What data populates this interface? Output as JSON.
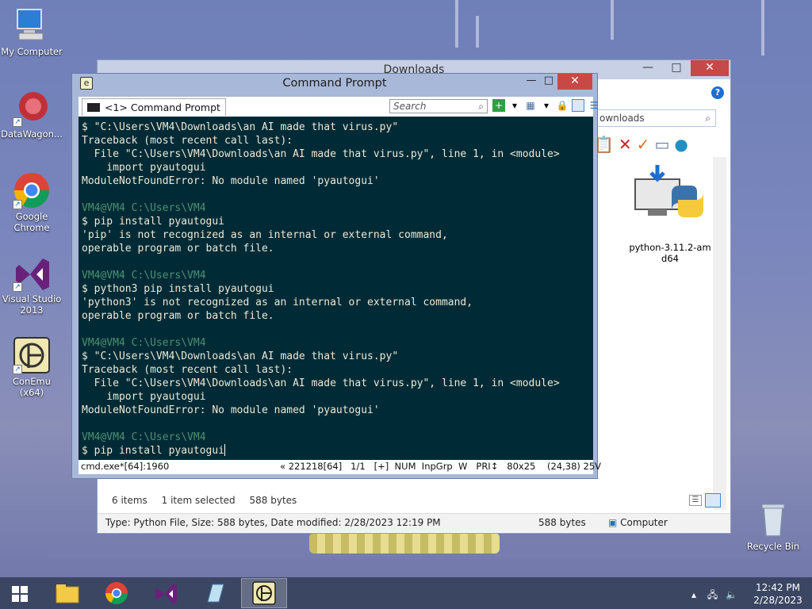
{
  "desktop": {
    "icons": [
      {
        "label": "My Computer"
      },
      {
        "label": "DataWagon..."
      },
      {
        "label": "Google Chrome"
      },
      {
        "label": "Visual Studio 2013"
      },
      {
        "label": "ConEmu (x64)"
      },
      {
        "label": "Recycle Bin"
      }
    ]
  },
  "explorer": {
    "title": "Downloads",
    "search_text": "ownloads",
    "file_name": "python-3.11.2-amd64",
    "status": {
      "items": "6 items",
      "selected": "1 item selected",
      "size": "588 bytes"
    },
    "details": {
      "info": "Type: Python File, Size: 588 bytes, Date modified: 2/28/2023 12:19 PM",
      "size": "588 bytes",
      "location": "Computer"
    }
  },
  "console": {
    "title": "Command Prompt",
    "tab_label": "<1> Command Prompt",
    "search_placeholder": "Search",
    "lines": [
      "$ \"C:\\Users\\VM4\\Downloads\\an AI made that virus.py\"",
      "Traceback (most recent call last):",
      "  File \"C:\\Users\\VM4\\Downloads\\an AI made that virus.py\", line 1, in <module>",
      "    import pyautogui",
      "ModuleNotFoundError: No module named 'pyautogui'",
      "",
      "VM4@VM4 C:\\Users\\VM4",
      "$ pip install pyautogui",
      "'pip' is not recognized as an internal or external command,",
      "operable program or batch file.",
      "",
      "VM4@VM4 C:\\Users\\VM4",
      "$ python3 pip install pyautogui",
      "'python3' is not recognized as an internal or external command,",
      "operable program or batch file.",
      "",
      "VM4@VM4 C:\\Users\\VM4",
      "$ \"C:\\Users\\VM4\\Downloads\\an AI made that virus.py\"",
      "Traceback (most recent call last):",
      "  File \"C:\\Users\\VM4\\Downloads\\an AI made that virus.py\", line 1, in <module>",
      "    import pyautogui",
      "ModuleNotFoundError: No module named 'pyautogui'",
      "",
      "VM4@VM4 C:\\Users\\VM4",
      "$ pip install pyautogui"
    ],
    "status_left": "cmd.exe*[64]:1960",
    "status_right": "« 221218[64]   1/1   [+]  NUM  InpGrp  W   PRI↕   80x25    (24,38) 25V"
  },
  "taskbar": {
    "clock_time": "12:42 PM",
    "clock_date": "2/28/2023"
  },
  "colors": {
    "terminal_bg": "#002b36",
    "terminal_fg": "#eee8d5",
    "prompt_host": "#4e8f70",
    "taskbar": "#3b4663"
  }
}
